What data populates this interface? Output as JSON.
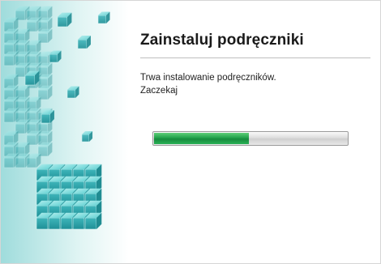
{
  "window": {
    "title": "Zainstaluj podręczniki",
    "status_line": "Trwa instalowanie podręczników.",
    "wait_line": "Zaczekaj"
  },
  "progress": {
    "fraction": 0.49
  },
  "art": {
    "icon": "cube-blocks-art",
    "accent": "#2bb3b8"
  },
  "colors": {
    "progress_fill": "#21a04a",
    "progress_track": "#d9d9d9"
  }
}
